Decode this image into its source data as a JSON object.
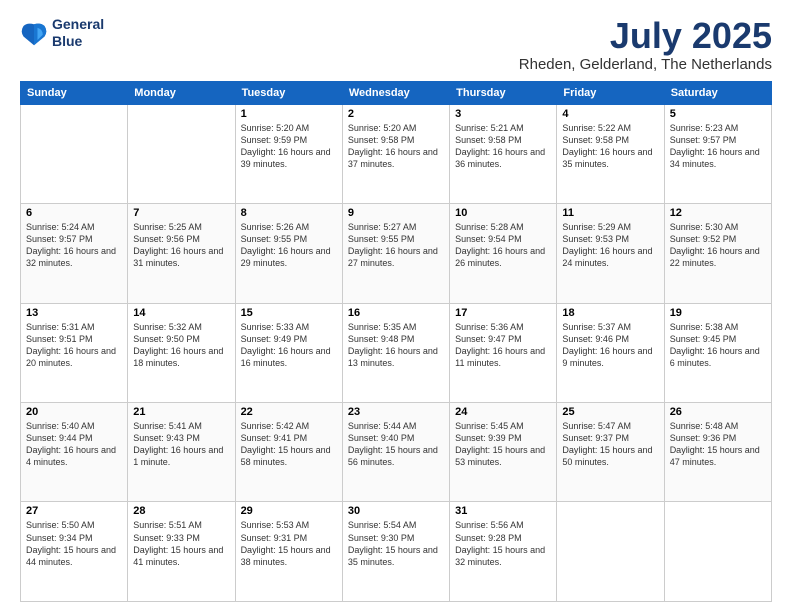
{
  "logo": {
    "line1": "General",
    "line2": "Blue"
  },
  "title": "July 2025",
  "subtitle": "Rheden, Gelderland, The Netherlands",
  "headers": [
    "Sunday",
    "Monday",
    "Tuesday",
    "Wednesday",
    "Thursday",
    "Friday",
    "Saturday"
  ],
  "weeks": [
    [
      {
        "day": "",
        "content": ""
      },
      {
        "day": "",
        "content": ""
      },
      {
        "day": "1",
        "content": "Sunrise: 5:20 AM\nSunset: 9:59 PM\nDaylight: 16 hours\nand 39 minutes."
      },
      {
        "day": "2",
        "content": "Sunrise: 5:20 AM\nSunset: 9:58 PM\nDaylight: 16 hours\nand 37 minutes."
      },
      {
        "day": "3",
        "content": "Sunrise: 5:21 AM\nSunset: 9:58 PM\nDaylight: 16 hours\nand 36 minutes."
      },
      {
        "day": "4",
        "content": "Sunrise: 5:22 AM\nSunset: 9:58 PM\nDaylight: 16 hours\nand 35 minutes."
      },
      {
        "day": "5",
        "content": "Sunrise: 5:23 AM\nSunset: 9:57 PM\nDaylight: 16 hours\nand 34 minutes."
      }
    ],
    [
      {
        "day": "6",
        "content": "Sunrise: 5:24 AM\nSunset: 9:57 PM\nDaylight: 16 hours\nand 32 minutes."
      },
      {
        "day": "7",
        "content": "Sunrise: 5:25 AM\nSunset: 9:56 PM\nDaylight: 16 hours\nand 31 minutes."
      },
      {
        "day": "8",
        "content": "Sunrise: 5:26 AM\nSunset: 9:55 PM\nDaylight: 16 hours\nand 29 minutes."
      },
      {
        "day": "9",
        "content": "Sunrise: 5:27 AM\nSunset: 9:55 PM\nDaylight: 16 hours\nand 27 minutes."
      },
      {
        "day": "10",
        "content": "Sunrise: 5:28 AM\nSunset: 9:54 PM\nDaylight: 16 hours\nand 26 minutes."
      },
      {
        "day": "11",
        "content": "Sunrise: 5:29 AM\nSunset: 9:53 PM\nDaylight: 16 hours\nand 24 minutes."
      },
      {
        "day": "12",
        "content": "Sunrise: 5:30 AM\nSunset: 9:52 PM\nDaylight: 16 hours\nand 22 minutes."
      }
    ],
    [
      {
        "day": "13",
        "content": "Sunrise: 5:31 AM\nSunset: 9:51 PM\nDaylight: 16 hours\nand 20 minutes."
      },
      {
        "day": "14",
        "content": "Sunrise: 5:32 AM\nSunset: 9:50 PM\nDaylight: 16 hours\nand 18 minutes."
      },
      {
        "day": "15",
        "content": "Sunrise: 5:33 AM\nSunset: 9:49 PM\nDaylight: 16 hours\nand 16 minutes."
      },
      {
        "day": "16",
        "content": "Sunrise: 5:35 AM\nSunset: 9:48 PM\nDaylight: 16 hours\nand 13 minutes."
      },
      {
        "day": "17",
        "content": "Sunrise: 5:36 AM\nSunset: 9:47 PM\nDaylight: 16 hours\nand 11 minutes."
      },
      {
        "day": "18",
        "content": "Sunrise: 5:37 AM\nSunset: 9:46 PM\nDaylight: 16 hours\nand 9 minutes."
      },
      {
        "day": "19",
        "content": "Sunrise: 5:38 AM\nSunset: 9:45 PM\nDaylight: 16 hours\nand 6 minutes."
      }
    ],
    [
      {
        "day": "20",
        "content": "Sunrise: 5:40 AM\nSunset: 9:44 PM\nDaylight: 16 hours\nand 4 minutes."
      },
      {
        "day": "21",
        "content": "Sunrise: 5:41 AM\nSunset: 9:43 PM\nDaylight: 16 hours\nand 1 minute."
      },
      {
        "day": "22",
        "content": "Sunrise: 5:42 AM\nSunset: 9:41 PM\nDaylight: 15 hours\nand 58 minutes."
      },
      {
        "day": "23",
        "content": "Sunrise: 5:44 AM\nSunset: 9:40 PM\nDaylight: 15 hours\nand 56 minutes."
      },
      {
        "day": "24",
        "content": "Sunrise: 5:45 AM\nSunset: 9:39 PM\nDaylight: 15 hours\nand 53 minutes."
      },
      {
        "day": "25",
        "content": "Sunrise: 5:47 AM\nSunset: 9:37 PM\nDaylight: 15 hours\nand 50 minutes."
      },
      {
        "day": "26",
        "content": "Sunrise: 5:48 AM\nSunset: 9:36 PM\nDaylight: 15 hours\nand 47 minutes."
      }
    ],
    [
      {
        "day": "27",
        "content": "Sunrise: 5:50 AM\nSunset: 9:34 PM\nDaylight: 15 hours\nand 44 minutes."
      },
      {
        "day": "28",
        "content": "Sunrise: 5:51 AM\nSunset: 9:33 PM\nDaylight: 15 hours\nand 41 minutes."
      },
      {
        "day": "29",
        "content": "Sunrise: 5:53 AM\nSunset: 9:31 PM\nDaylight: 15 hours\nand 38 minutes."
      },
      {
        "day": "30",
        "content": "Sunrise: 5:54 AM\nSunset: 9:30 PM\nDaylight: 15 hours\nand 35 minutes."
      },
      {
        "day": "31",
        "content": "Sunrise: 5:56 AM\nSunset: 9:28 PM\nDaylight: 15 hours\nand 32 minutes."
      },
      {
        "day": "",
        "content": ""
      },
      {
        "day": "",
        "content": ""
      }
    ]
  ]
}
